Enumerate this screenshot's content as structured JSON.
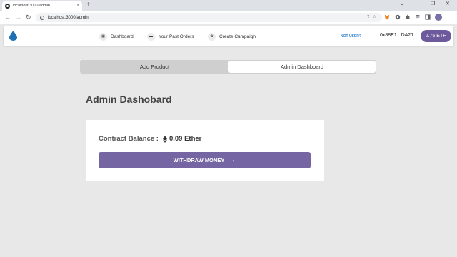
{
  "browser": {
    "tab_title": "localhost:3000/admin",
    "tab_close": "×",
    "new_tab": "+",
    "url": "localhost:3000/admin",
    "window_controls": [
      "⌄",
      "–",
      "❐",
      "✕"
    ]
  },
  "navbar": {
    "links": [
      {
        "label": "Dashboard",
        "icon": "grid-icon"
      },
      {
        "label": "Your Past Orders",
        "icon": "orders-icon"
      },
      {
        "label": "Create Campaign",
        "icon": "campaign-icon"
      }
    ],
    "not_user": "NOT USER?",
    "address": "0x88E1...DA21",
    "balance_badge": "2.75 ETH"
  },
  "tabs": [
    {
      "label": "Add Product",
      "active": false
    },
    {
      "label": "Admin Dashboard",
      "active": true
    }
  ],
  "page": {
    "heading": "Admin Dashobard",
    "balance_label": "Contract Balance :",
    "balance_value": "0.09 Ether",
    "withdraw_label": "WITHDRAW MONEY",
    "withdraw_arrow": "→"
  },
  "colors": {
    "accent": "#6c5a9d",
    "button": "#7565a2",
    "background": "#e8e8e9"
  }
}
